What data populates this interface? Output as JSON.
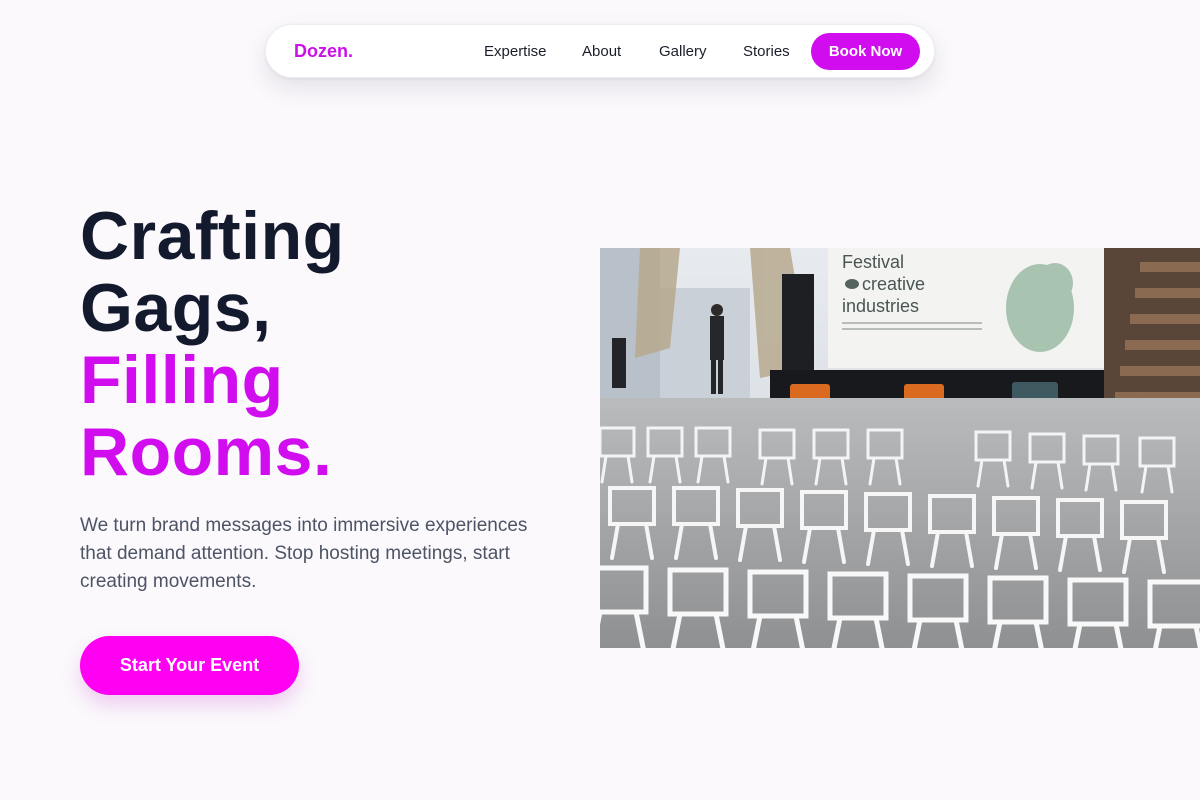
{
  "nav": {
    "logo": "Dozen.",
    "links": [
      {
        "label": "Expertise"
      },
      {
        "label": "About"
      },
      {
        "label": "Gallery"
      },
      {
        "label": "Stories"
      }
    ],
    "cta_label": "Book Now"
  },
  "hero": {
    "title_line1": "Crafting",
    "title_line2": "Gags,",
    "title_line3": "Filling",
    "title_line4": "Rooms.",
    "subtitle": "We turn brand messages into immersive experiences that demand attention. Stop hosting meetings, start creating movements.",
    "cta_label": "Start Your Event",
    "image": {
      "screen_line1": "Festival",
      "screen_line2": "creative",
      "screen_line3": "industries"
    }
  },
  "colors": {
    "accent": "#d10df0",
    "cta": "#ff00f2",
    "heading": "#141a2e",
    "background": "#fbf9fc"
  }
}
